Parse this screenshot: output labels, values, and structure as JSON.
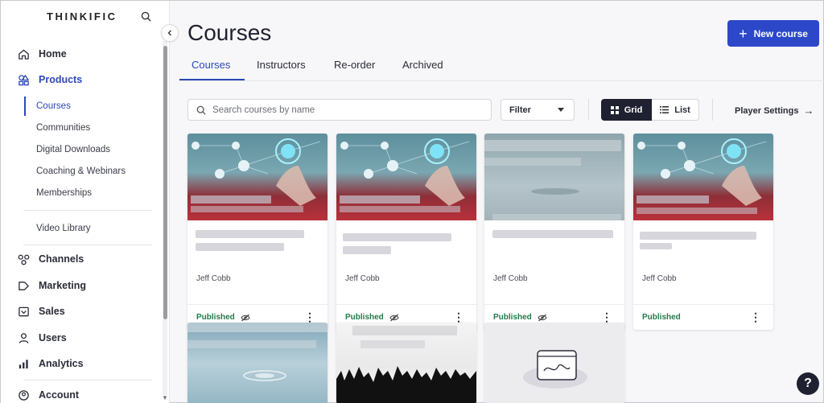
{
  "brand": {
    "name": "THINKIFIC"
  },
  "sidebar": {
    "nav": [
      {
        "label": "Home",
        "icon": "home-icon"
      },
      {
        "label": "Products",
        "icon": "products-icon"
      },
      {
        "label": "Channels",
        "icon": "channels-icon"
      },
      {
        "label": "Marketing",
        "icon": "marketing-icon"
      },
      {
        "label": "Sales",
        "icon": "sales-icon"
      },
      {
        "label": "Users",
        "icon": "users-icon"
      },
      {
        "label": "Analytics",
        "icon": "analytics-icon"
      },
      {
        "label": "Account",
        "icon": "account-icon"
      }
    ],
    "products_sub": [
      "Courses",
      "Communities",
      "Digital Downloads",
      "Coaching & Webinars",
      "Memberships"
    ],
    "video_library": "Video Library"
  },
  "header": {
    "title": "Courses",
    "new_course_label": "New course"
  },
  "tabs": [
    "Courses",
    "Instructors",
    "Re-order",
    "Archived"
  ],
  "toolbar": {
    "search_placeholder": "Search courses by name",
    "filter_label": "Filter",
    "grid_label": "Grid",
    "list_label": "List",
    "player_settings_label": "Player Settings"
  },
  "courses": [
    {
      "author": "Jeff Cobb",
      "status": "Published",
      "hidden_icon": true
    },
    {
      "author": "Jeff Cobb",
      "status": "Published",
      "hidden_icon": true
    },
    {
      "author": "Jeff Cobb",
      "status": "Published",
      "hidden_icon": true
    },
    {
      "author": "Jeff Cobb",
      "status": "Published",
      "hidden_icon": false
    }
  ],
  "colors": {
    "accent": "#2c48b8",
    "button": "#2c48c9",
    "published": "#227a4a",
    "dark": "#1f2130"
  },
  "help": {
    "label": "?"
  }
}
